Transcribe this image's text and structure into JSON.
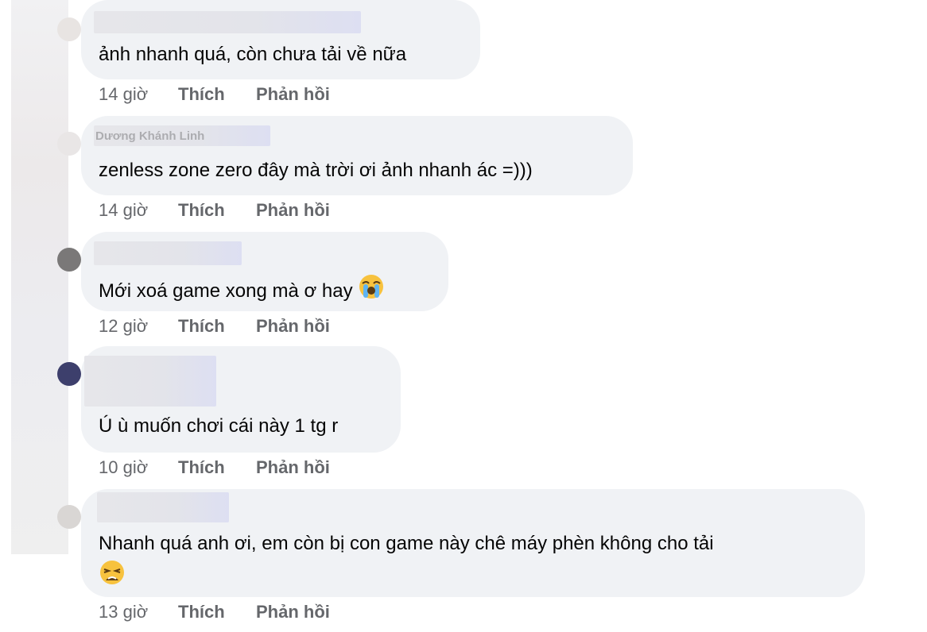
{
  "comments": [
    {
      "author": "",
      "text": "ảnh nhanh quá, còn chưa tải về nữa",
      "time": "14 giờ",
      "like_label": "Thích",
      "reply_label": "Phản hồi"
    },
    {
      "author": "Dương Khánh Linh",
      "text": "zenless zone zero đây mà trời ơi ảnh nhanh ác =)))",
      "time": "14 giờ",
      "like_label": "Thích",
      "reply_label": "Phản hồi"
    },
    {
      "author": "",
      "text": "Mới xoá game xong mà ơ hay",
      "emoji": "loudly-crying-face",
      "time": "12 giờ",
      "like_label": "Thích",
      "reply_label": "Phản hồi"
    },
    {
      "author": "",
      "text": "Ú ù muốn chơi cái này 1 tg r",
      "time": "10 giờ",
      "like_label": "Thích",
      "reply_label": "Phản hồi"
    },
    {
      "author": "",
      "text": "Nhanh quá anh ơi, em còn bị con game này chê máy phèn không cho tải",
      "emoji": "weary-face",
      "time": "13 giờ",
      "like_label": "Thích",
      "reply_label": "Phản hồi"
    }
  ],
  "colors": {
    "bubble": "#f0f2f5",
    "meta_text": "#65676b",
    "body_text": "#050505"
  }
}
